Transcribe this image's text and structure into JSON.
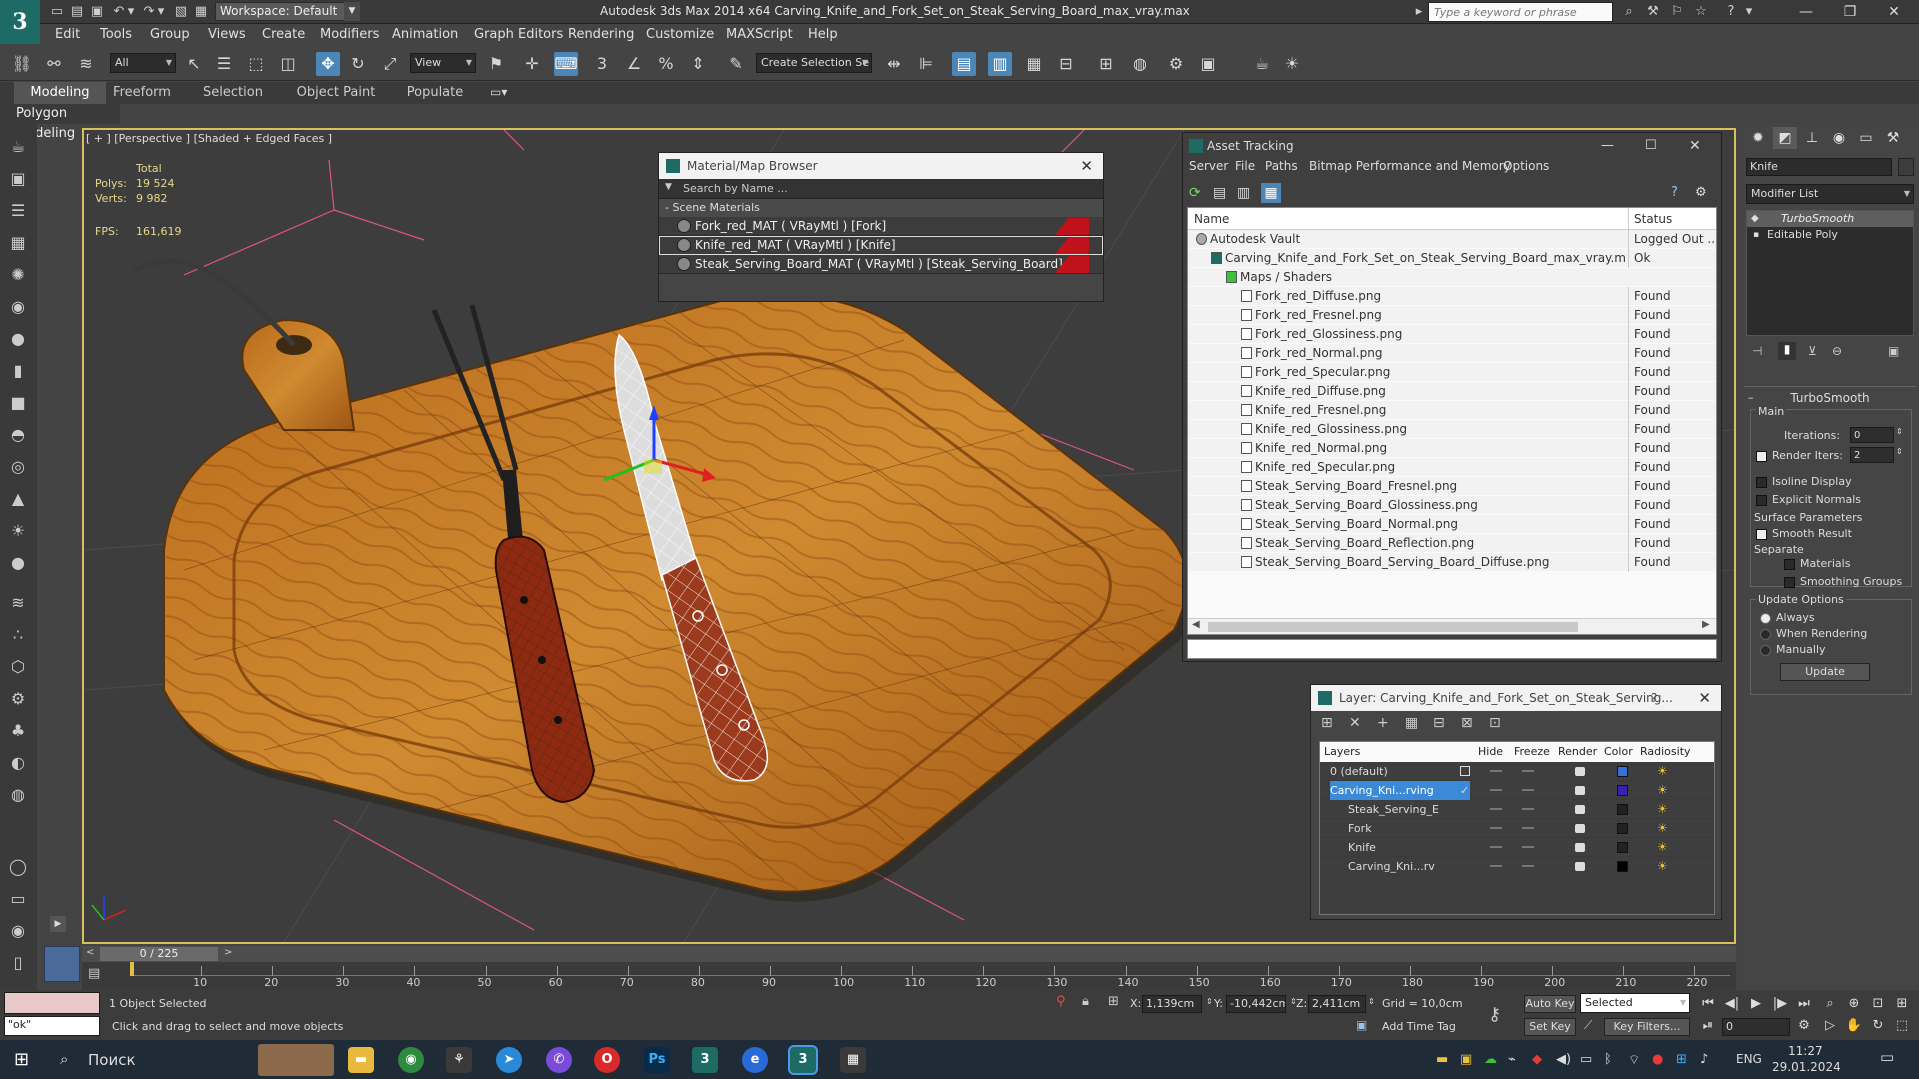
{
  "titlebar": {
    "workspace": "Workspace: Default",
    "title": "Autodesk 3ds Max  2014 x64     Carving_Knife_and_Fork_Set_on_Steak_Serving_Board_max_vray.max",
    "search_placeholder": "Type a keyword or phrase"
  },
  "menus": [
    "Edit",
    "Tools",
    "Group",
    "Views",
    "Create",
    "Modifiers",
    "Animation",
    "Graph Editors",
    "Rendering",
    "Customize",
    "MAXScript",
    "Help"
  ],
  "toolbar": {
    "filter": "All",
    "refcoord": "View",
    "selection_set": "Create Selection Se"
  },
  "ribbon": {
    "tabs": [
      "Modeling",
      "Freeform",
      "Selection",
      "Object Paint",
      "Populate"
    ],
    "sub": "Polygon Modeling"
  },
  "viewport": {
    "label": "[ + ] [Perspective ] [Shaded + Edged Faces ]",
    "stats": {
      "total_label": "Total",
      "polys_label": "Polys:",
      "polys": "19 524",
      "verts_label": "Verts:",
      "verts": "9 982",
      "fps_label": "FPS:",
      "fps": "161,619"
    }
  },
  "material_browser": {
    "title": "Material/Map Browser",
    "search": "Search by Name ...",
    "section": "- Scene Materials",
    "materials": [
      "Fork_red_MAT  ( VRayMtl ) [Fork]",
      "Knife_red_MAT  ( VRayMtl ) [Knife]",
      "Steak_Serving_Board_MAT  ( VRayMtl ) [Steak_Serving_Board]"
    ]
  },
  "asset_tracking": {
    "title": "Asset Tracking",
    "menus": [
      "Server",
      "File",
      "Paths",
      "Bitmap Performance and Memory",
      "Options"
    ],
    "col_name": "Name",
    "col_status": "Status",
    "rows": [
      {
        "name": "Autodesk Vault",
        "status": "Logged Out ...",
        "indent": 0
      },
      {
        "name": "Carving_Knife_and_Fork_Set_on_Steak_Serving_Board_max_vray.max",
        "status": "Ok",
        "indent": 1
      },
      {
        "name": "Maps / Shaders",
        "status": "",
        "indent": 2
      },
      {
        "name": "Fork_red_Diffuse.png",
        "status": "Found",
        "indent": 3
      },
      {
        "name": "Fork_red_Fresnel.png",
        "status": "Found",
        "indent": 3
      },
      {
        "name": "Fork_red_Glossiness.png",
        "status": "Found",
        "indent": 3
      },
      {
        "name": "Fork_red_Normal.png",
        "status": "Found",
        "indent": 3
      },
      {
        "name": "Fork_red_Specular.png",
        "status": "Found",
        "indent": 3
      },
      {
        "name": "Knife_red_Diffuse.png",
        "status": "Found",
        "indent": 3
      },
      {
        "name": "Knife_red_Fresnel.png",
        "status": "Found",
        "indent": 3
      },
      {
        "name": "Knife_red_Glossiness.png",
        "status": "Found",
        "indent": 3
      },
      {
        "name": "Knife_red_Normal.png",
        "status": "Found",
        "indent": 3
      },
      {
        "name": "Knife_red_Specular.png",
        "status": "Found",
        "indent": 3
      },
      {
        "name": "Steak_Serving_Board_Fresnel.png",
        "status": "Found",
        "indent": 3
      },
      {
        "name": "Steak_Serving_Board_Glossiness.png",
        "status": "Found",
        "indent": 3
      },
      {
        "name": "Steak_Serving_Board_Normal.png",
        "status": "Found",
        "indent": 3
      },
      {
        "name": "Steak_Serving_Board_Reflection.png",
        "status": "Found",
        "indent": 3
      },
      {
        "name": "Steak_Serving_Board_Serving_Board_Diffuse.png",
        "status": "Found",
        "indent": 3
      }
    ]
  },
  "layer_window": {
    "title": "Layer: Carving_Knife_and_Fork_Set_on_Steak_Serving...",
    "help": "?",
    "cols": [
      "Layers",
      "Hide",
      "Freeze",
      "Render",
      "Color",
      "Radiosity"
    ],
    "rows": [
      {
        "name": "0 (default)",
        "indent": 0,
        "color": "#3a6fd8"
      },
      {
        "name": "Carving_Kni...rving",
        "indent": 0,
        "color": "#3a1fb0",
        "selected": true
      },
      {
        "name": "Steak_Serving_E",
        "indent": 1,
        "color": "#222222"
      },
      {
        "name": "Fork",
        "indent": 1,
        "color": "#222222"
      },
      {
        "name": "Knife",
        "indent": 1,
        "color": "#222222"
      },
      {
        "name": "Carving_Kni...rv",
        "indent": 1,
        "color": "#000000"
      }
    ]
  },
  "command_panel": {
    "object_name": "Knife",
    "modifier_list": "Modifier List",
    "stack": [
      "TurboSmooth",
      "Editable Poly"
    ],
    "rollout_title": "TurboSmooth",
    "main_label": "Main",
    "iterations_label": "Iterations:",
    "iterations": "0",
    "render_iters_label": "Render Iters:",
    "render_iters": "2",
    "isoline": "Isoline Display",
    "explicit_normals": "Explicit Normals",
    "surface_params": "Surface Parameters",
    "smooth_result": "Smooth Result",
    "separate": "Separate",
    "materials": "Materials",
    "smoothing_groups": "Smoothing Groups",
    "update_options": "Update Options",
    "always": "Always",
    "when_rendering": "When Rendering",
    "manually": "Manually",
    "update_btn": "Update"
  },
  "timeline": {
    "frame": "0 / 225",
    "ticks": [
      "10",
      "20",
      "30",
      "40",
      "50",
      "60",
      "70",
      "80",
      "90",
      "100",
      "110",
      "120",
      "130",
      "140",
      "150",
      "160",
      "170",
      "180",
      "190",
      "200",
      "210",
      "220"
    ]
  },
  "status": {
    "script": "\"ok\"",
    "selected": "1 Object Selected",
    "prompt": "Click and drag to select and move objects",
    "x_label": "X:",
    "x": "1,139cm",
    "y_label": "Y:",
    "y": "-10,442cm",
    "z_label": "Z:",
    "z": "2,411cm",
    "grid": "Grid = 10,0cm",
    "add_time_tag": "Add Time Tag",
    "auto_key": "Auto Key",
    "set_key": "Set Key",
    "selected_dd": "Selected",
    "key_filters": "Key Filters...",
    "frame_field": "0"
  },
  "taskbar": {
    "search": "Поиск",
    "lang": "ENG",
    "time": "11:27",
    "date": "29.01.2024"
  }
}
